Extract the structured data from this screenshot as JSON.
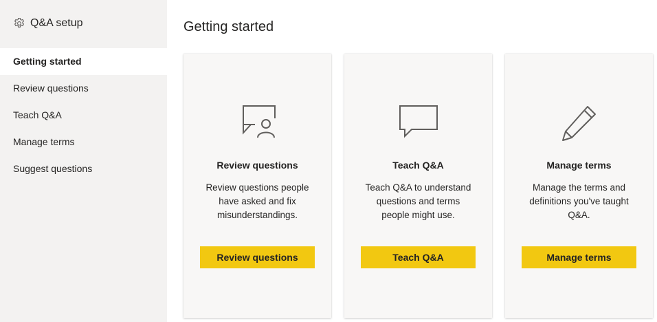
{
  "sidebar": {
    "title": "Q&A setup",
    "title_icon": "gear-icon",
    "items": [
      {
        "label": "Getting started",
        "active": true
      },
      {
        "label": "Review questions",
        "active": false
      },
      {
        "label": "Teach Q&A",
        "active": false
      },
      {
        "label": "Manage terms",
        "active": false
      },
      {
        "label": "Suggest questions",
        "active": false
      }
    ]
  },
  "main": {
    "title": "Getting started",
    "cards": [
      {
        "icon": "chat-person-icon",
        "title": "Review questions",
        "description": "Review questions people have asked and fix misunderstandings.",
        "button_label": "Review questions"
      },
      {
        "icon": "chat-bubble-icon",
        "title": "Teach Q&A",
        "description": "Teach Q&A to understand questions and terms people might use.",
        "button_label": "Teach Q&A"
      },
      {
        "icon": "pencil-icon",
        "title": "Manage terms",
        "description": "Manage the terms and definitions you've taught Q&A.",
        "button_label": "Manage terms"
      }
    ]
  },
  "colors": {
    "accent_button": "#f2c811",
    "sidebar_bg": "#f3f2f1",
    "card_bg": "#f8f7f6",
    "text": "#252423",
    "icon_stroke": "#605e5c"
  }
}
